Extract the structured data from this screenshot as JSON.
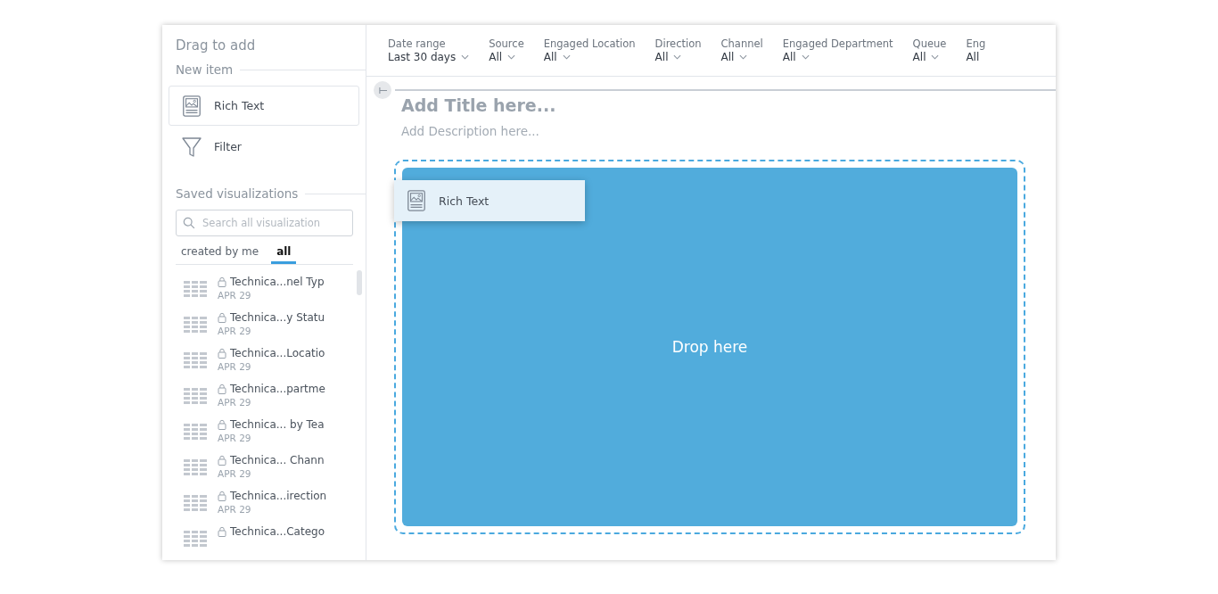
{
  "sidebar": {
    "title": "Drag to add",
    "new_item_heading": "New item",
    "new_items": [
      {
        "label": "Rich Text",
        "kind": "richtext",
        "selected": true
      },
      {
        "label": "Filter",
        "kind": "filter",
        "selected": false
      }
    ],
    "saved_heading": "Saved visualizations",
    "search": {
      "placeholder": "Search all visualization"
    },
    "tabs": [
      {
        "label": "created by me",
        "selected": false
      },
      {
        "label": "all",
        "selected": true
      }
    ],
    "items": [
      {
        "name": "Technica...nel Typ",
        "date": "APR 29"
      },
      {
        "name": "Technica...y Statu",
        "date": "APR 29"
      },
      {
        "name": "Technica...Locatio",
        "date": "APR 29"
      },
      {
        "name": "Technica...partme",
        "date": "APR 29"
      },
      {
        "name": "Technica... by Tea",
        "date": "APR 29"
      },
      {
        "name": "Technica... Chann",
        "date": "APR 29"
      },
      {
        "name": "Technica...irection",
        "date": "APR 29"
      },
      {
        "name": "Technica...Catego"
      }
    ]
  },
  "filters": [
    {
      "label": "Date range",
      "value": "Last 30 days"
    },
    {
      "label": "Source",
      "value": "All"
    },
    {
      "label": "Engaged Location",
      "value": "All"
    },
    {
      "label": "Direction",
      "value": "All"
    },
    {
      "label": "Channel",
      "value": "All"
    },
    {
      "label": "Engaged Department",
      "value": "All"
    },
    {
      "label": "Queue",
      "value": "All"
    },
    {
      "label": "Eng",
      "value": "All"
    }
  ],
  "canvas": {
    "title_placeholder": "Add Title here...",
    "description_placeholder": "Add Description here...",
    "drop_label": "Drop here",
    "dragging": {
      "label": "Rich Text"
    }
  }
}
